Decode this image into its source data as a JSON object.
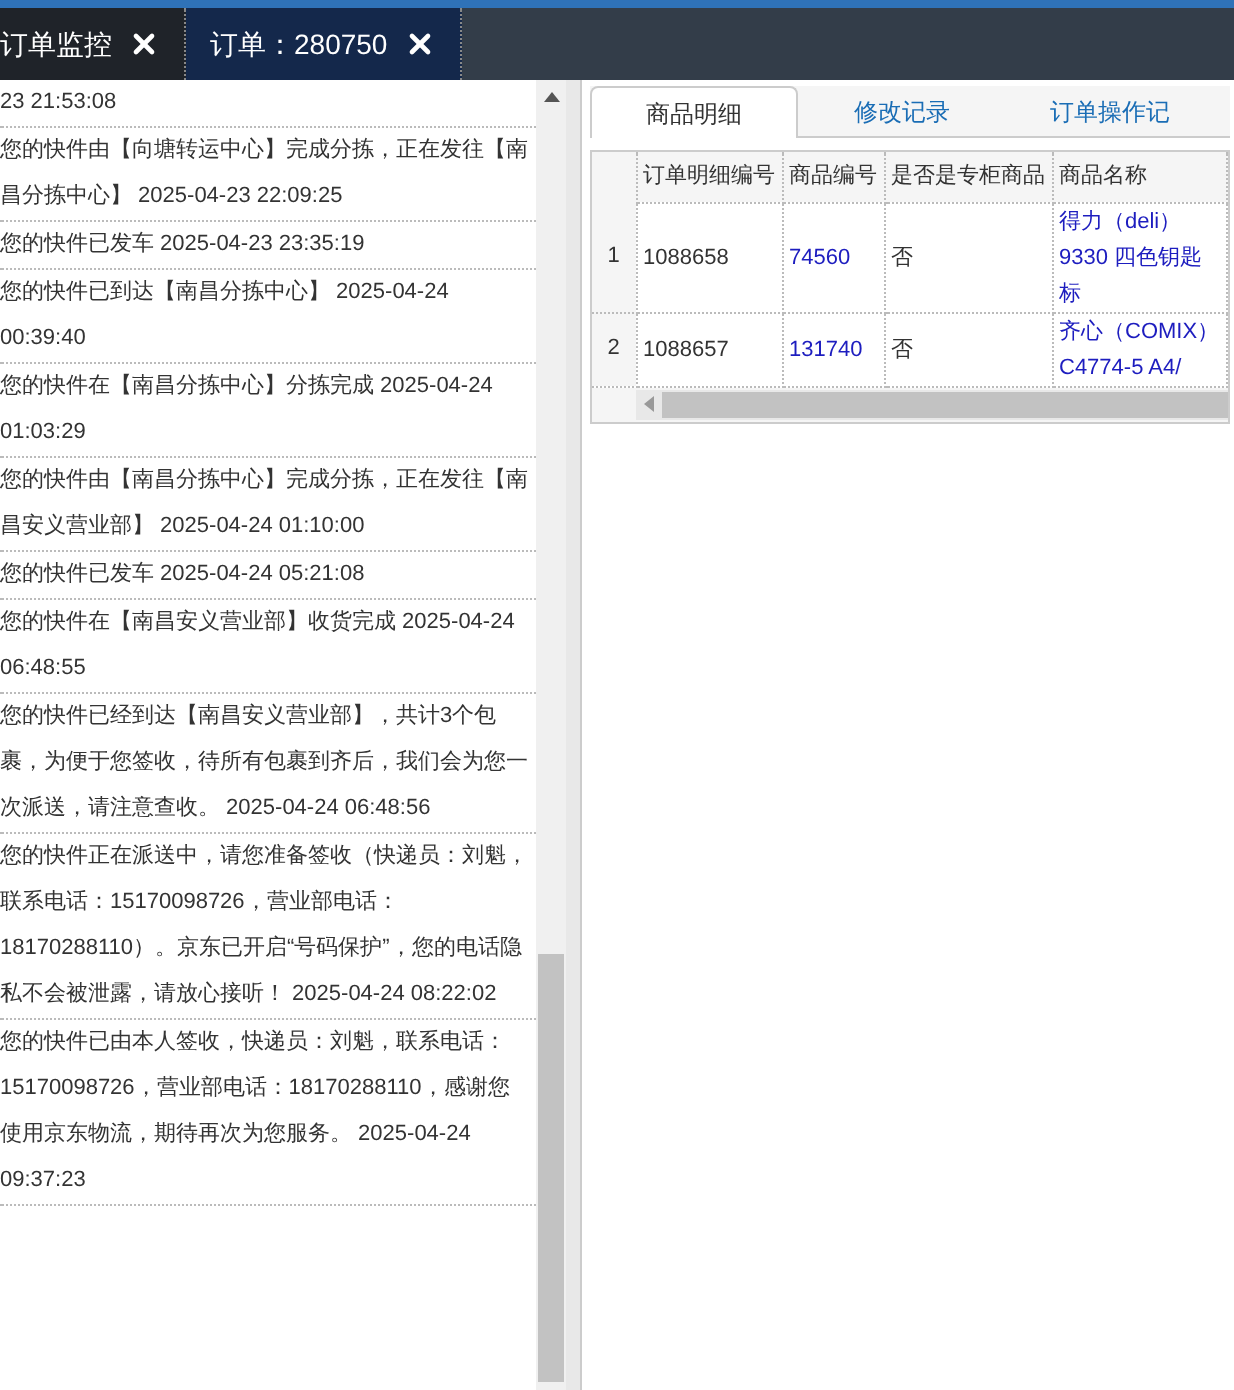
{
  "tabs": [
    {
      "label": "订单监控",
      "selected": false
    },
    {
      "label": "订单：280750",
      "selected": true
    }
  ],
  "tracking_events": [
    {
      "text": "23 21:53:08"
    },
    {
      "text": "您的快件由【向塘转运中心】完成分拣，正在发往【南昌分拣中心】 2025-04-23 22:09:25"
    },
    {
      "text": "您的快件已发车 2025-04-23 23:35:19"
    },
    {
      "text": "您的快件已到达【南昌分拣中心】 2025-04-24 00:39:40"
    },
    {
      "text": "您的快件在【南昌分拣中心】分拣完成 2025-04-24 01:03:29"
    },
    {
      "text": "您的快件由【南昌分拣中心】完成分拣，正在发往【南昌安义营业部】 2025-04-24 01:10:00"
    },
    {
      "text": "您的快件已发车 2025-04-24 05:21:08"
    },
    {
      "text": "您的快件在【南昌安义营业部】收货完成 2025-04-24 06:48:55"
    },
    {
      "text": "您的快件已经到达【南昌安义营业部】，共计3个包裹，为便于您签收，待所有包裹到齐后，我们会为您一次派送，请注意查收。 2025-04-24 06:48:56"
    },
    {
      "text": "您的快件正在派送中，请您准备签收（快递员：刘魁，联系电话：15170098726，营业部电话：18170288110）。京东已开启“号码保护”，您的电话隐私不会被泄露，请放心接听！ 2025-04-24 08:22:02"
    },
    {
      "text": "您的快件已由本人签收，快递员：刘魁，联系电话：15170098726，营业部电话：18170288110，感谢您使用京东物流，期待再次为您服务。 2025-04-24 09:37:23"
    }
  ],
  "detail_tabs": [
    {
      "label": "商品明细",
      "selected": true
    },
    {
      "label": "修改记录",
      "selected": false
    },
    {
      "label": "订单操作记",
      "selected": false
    }
  ],
  "table": {
    "columns": [
      {
        "label": "订单明细编号",
        "kind": "text"
      },
      {
        "label": "商品编号",
        "kind": "link"
      },
      {
        "label": "是否是专柜商品",
        "kind": "text"
      },
      {
        "label": "商品名称",
        "kind": "link"
      }
    ],
    "rows": [
      {
        "number": "1",
        "cells": [
          "1088658",
          "74560",
          "否",
          "得力（deli） 9330 四色钥匙标"
        ]
      },
      {
        "number": "2",
        "cells": [
          "1088657",
          "131740",
          "否",
          "齐心（COMIX） C4774-5 A4/"
        ]
      }
    ]
  }
}
